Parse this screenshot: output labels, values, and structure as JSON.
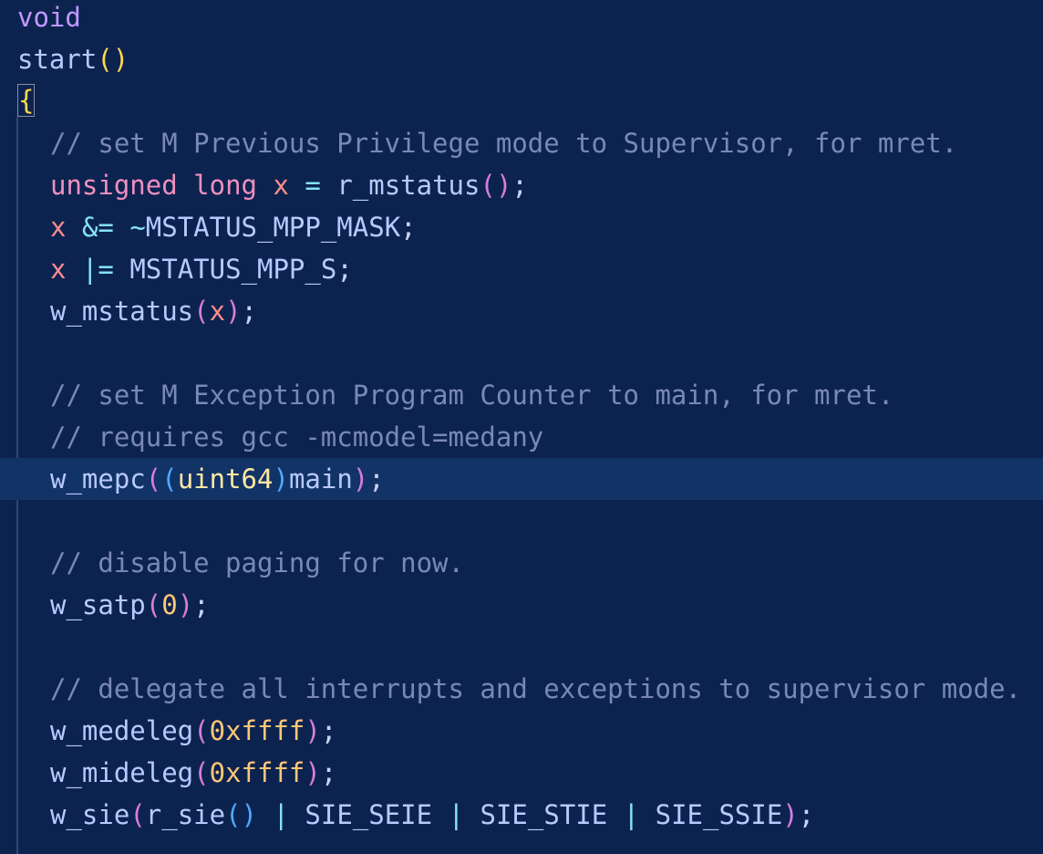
{
  "editor": {
    "lines": [
      {
        "tokens": [
          {
            "t": "void",
            "c": "t-void"
          }
        ]
      },
      {
        "tokens": [
          {
            "t": "start",
            "c": "t-fn"
          },
          {
            "t": "()",
            "c": "t-p1"
          }
        ]
      },
      {
        "tokens": [
          {
            "t": "{",
            "c": "t-p1"
          }
        ]
      },
      {
        "tokens": [
          {
            "t": "// set M Previous Privilege mode to Supervisor, for mret.",
            "c": "t-cmt"
          }
        ]
      },
      {
        "tokens": [
          {
            "t": "unsigned",
            "c": "t-type"
          },
          {
            "t": " ",
            "c": "t-plain"
          },
          {
            "t": "long",
            "c": "t-type"
          },
          {
            "t": " ",
            "c": "t-plain"
          },
          {
            "t": "x",
            "c": "t-var"
          },
          {
            "t": " ",
            "c": "t-plain"
          },
          {
            "t": "=",
            "c": "t-op"
          },
          {
            "t": " ",
            "c": "t-plain"
          },
          {
            "t": "r_mstatus",
            "c": "t-fn"
          },
          {
            "t": "()",
            "c": "t-p2"
          },
          {
            "t": ";",
            "c": "t-plain"
          }
        ]
      },
      {
        "tokens": [
          {
            "t": "x",
            "c": "t-var"
          },
          {
            "t": " ",
            "c": "t-plain"
          },
          {
            "t": "&=",
            "c": "t-op"
          },
          {
            "t": " ",
            "c": "t-plain"
          },
          {
            "t": "~",
            "c": "t-op"
          },
          {
            "t": "MSTATUS_MPP_MASK",
            "c": "t-fn"
          },
          {
            "t": ";",
            "c": "t-plain"
          }
        ]
      },
      {
        "tokens": [
          {
            "t": "x",
            "c": "t-var"
          },
          {
            "t": " ",
            "c": "t-plain"
          },
          {
            "t": "|=",
            "c": "t-op"
          },
          {
            "t": " ",
            "c": "t-plain"
          },
          {
            "t": "MSTATUS_MPP_S",
            "c": "t-fn"
          },
          {
            "t": ";",
            "c": "t-plain"
          }
        ]
      },
      {
        "tokens": [
          {
            "t": "w_mstatus",
            "c": "t-fn"
          },
          {
            "t": "(",
            "c": "t-p2"
          },
          {
            "t": "x",
            "c": "t-var"
          },
          {
            "t": ")",
            "c": "t-p2"
          },
          {
            "t": ";",
            "c": "t-plain"
          }
        ]
      },
      {
        "tokens": []
      },
      {
        "tokens": [
          {
            "t": "// set M Exception Program Counter to main, for mret.",
            "c": "t-cmt"
          }
        ]
      },
      {
        "tokens": [
          {
            "t": "// requires gcc -mcmodel=medany",
            "c": "t-cmt"
          }
        ]
      },
      {
        "tokens": [
          {
            "t": "w_mepc",
            "c": "t-fn"
          },
          {
            "t": "(",
            "c": "t-p2"
          },
          {
            "t": "(",
            "c": "t-p3"
          },
          {
            "t": "uint64",
            "c": "t-cast"
          },
          {
            "t": ")",
            "c": "t-p3"
          },
          {
            "t": "main",
            "c": "t-fn"
          },
          {
            "t": ")",
            "c": "t-p2"
          },
          {
            "t": ";",
            "c": "t-plain"
          }
        ]
      },
      {
        "tokens": []
      },
      {
        "tokens": [
          {
            "t": "// disable paging for now.",
            "c": "t-cmt"
          }
        ]
      },
      {
        "tokens": [
          {
            "t": "w_satp",
            "c": "t-fn"
          },
          {
            "t": "(",
            "c": "t-p2"
          },
          {
            "t": "0",
            "c": "t-num"
          },
          {
            "t": ")",
            "c": "t-p2"
          },
          {
            "t": ";",
            "c": "t-plain"
          }
        ]
      },
      {
        "tokens": []
      },
      {
        "tokens": [
          {
            "t": "// delegate all interrupts and exceptions to supervisor mode.",
            "c": "t-cmt"
          }
        ]
      },
      {
        "tokens": [
          {
            "t": "w_medeleg",
            "c": "t-fn"
          },
          {
            "t": "(",
            "c": "t-p2"
          },
          {
            "t": "0xffff",
            "c": "t-num"
          },
          {
            "t": ")",
            "c": "t-p2"
          },
          {
            "t": ";",
            "c": "t-plain"
          }
        ]
      },
      {
        "tokens": [
          {
            "t": "w_mideleg",
            "c": "t-fn"
          },
          {
            "t": "(",
            "c": "t-p2"
          },
          {
            "t": "0xffff",
            "c": "t-num"
          },
          {
            "t": ")",
            "c": "t-p2"
          },
          {
            "t": ";",
            "c": "t-plain"
          }
        ]
      },
      {
        "tokens": [
          {
            "t": "w_sie",
            "c": "t-fn"
          },
          {
            "t": "(",
            "c": "t-p2"
          },
          {
            "t": "r_sie",
            "c": "t-fn"
          },
          {
            "t": "()",
            "c": "t-p3"
          },
          {
            "t": " ",
            "c": "t-plain"
          },
          {
            "t": "|",
            "c": "t-op"
          },
          {
            "t": " ",
            "c": "t-plain"
          },
          {
            "t": "SIE_SEIE",
            "c": "t-fn"
          },
          {
            "t": " ",
            "c": "t-plain"
          },
          {
            "t": "|",
            "c": "t-op"
          },
          {
            "t": " ",
            "c": "t-plain"
          },
          {
            "t": "SIE_STIE",
            "c": "t-fn"
          },
          {
            "t": " ",
            "c": "t-plain"
          },
          {
            "t": "|",
            "c": "t-op"
          },
          {
            "t": " ",
            "c": "t-plain"
          },
          {
            "t": "SIE_SSIE",
            "c": "t-fn"
          },
          {
            "t": ")",
            "c": "t-p2"
          },
          {
            "t": ";",
            "c": "t-plain"
          }
        ]
      }
    ],
    "highlighted_line": 11,
    "bracket_match_line": 2,
    "colors": {
      "background": "#0c2350",
      "current_line": "#123366",
      "comment": "#7a88b8",
      "keyword": "#f08fc0",
      "variable": "#ff8d8d",
      "number": "#ffc777"
    }
  }
}
